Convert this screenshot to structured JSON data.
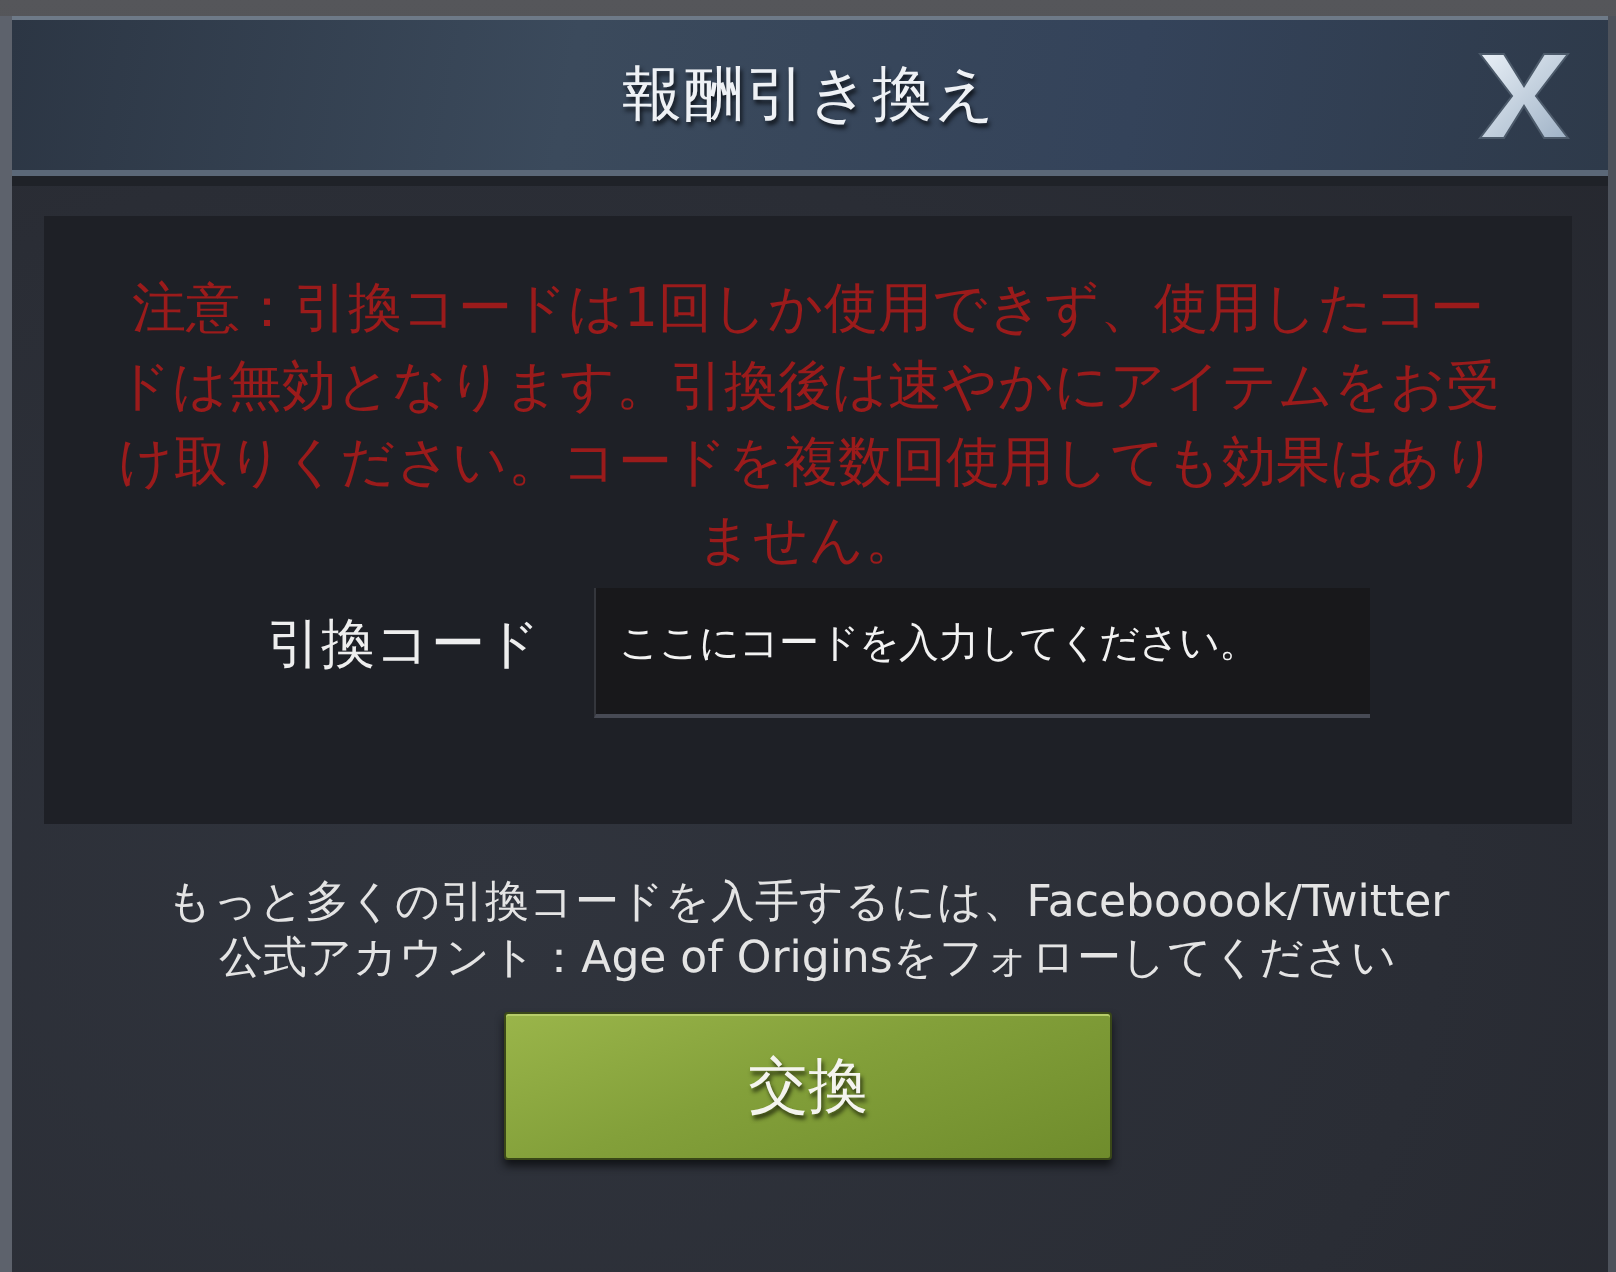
{
  "dialog": {
    "title": "報酬引き換え"
  },
  "notice": {
    "lines": [
      "注意：引換コードは1回しか使用できず、使用したコー",
      "ドは無効となります。引換後は速やかにアイテムをお受",
      "け取りください。コードを複数回使用しても効果はあり",
      "ません。"
    ]
  },
  "code_field": {
    "label": "引換コード",
    "placeholder": "ここにコードを入力してください。"
  },
  "info": {
    "lines": [
      "もっと多くの引換コードを入手するには、Facebooook/Twitter",
      "公式アカウント：Age of Originsをフォローしてください"
    ]
  },
  "submit_button": {
    "label": "交換"
  }
}
